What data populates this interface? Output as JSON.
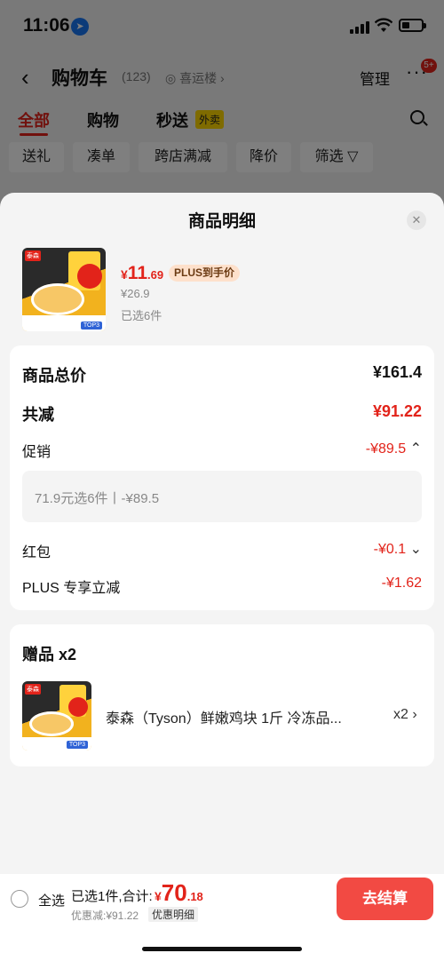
{
  "status_bar": {
    "time": "11:06"
  },
  "nav": {
    "title": "购物车",
    "count": "(123)",
    "address": "喜运楼 ›",
    "manage": "管理",
    "more_badge": "5+"
  },
  "tabs": [
    {
      "label": "全部"
    },
    {
      "label": "购物"
    },
    {
      "label": "秒送"
    }
  ],
  "tab_badge": "外卖",
  "filters": [
    "送礼",
    "凑单",
    "跨店满减",
    "降价",
    "筛选"
  ],
  "sheet": {
    "title": "商品明细",
    "product": {
      "currency": "¥",
      "price_int": "11",
      "price_dec": ".69",
      "plus_tag": "PLUS到手价",
      "original_price": "¥26.9",
      "selected": "已选6件",
      "thumb_brand": "泰森",
      "thumb_top": "TOP3"
    },
    "summary": {
      "total_label": "商品总价",
      "total_value": "¥161.4",
      "reduce_label": "共减",
      "reduce_value": "¥91.22",
      "promo_label": "促销",
      "promo_value": "-¥89.5",
      "promo_detail": "71.9元选6件丨-¥89.5",
      "redpacket_label": "红包",
      "redpacket_value": "-¥0.1",
      "plus_label": "PLUS 专享立减",
      "plus_value": "-¥1.62"
    },
    "gift": {
      "title": "赠品 x2",
      "name": "泰森（Tyson）鲜嫩鸡块 1斤 冷冻品...",
      "qty": "x2",
      "thumb_brand": "泰森",
      "thumb_top": "TOP3"
    }
  },
  "checkout": {
    "select_all": "全选",
    "summary_text": "已选1件,合计:",
    "currency": "¥",
    "total_int": "70",
    "total_dec": ".18",
    "discount_text": "优惠减:¥91.22",
    "detail_label": "优惠明细",
    "button_label": "去结算"
  },
  "colors": {
    "accent": "#e2231a",
    "button": "#f24a43",
    "plus_tag_bg": "#fde0cb",
    "badge_yellow": "#ffd600"
  },
  "icons": [
    "location-arrow-icon",
    "signal-icon",
    "wifi-icon",
    "battery-icon",
    "back-chevron-icon",
    "eye-icon",
    "more-dots-icon",
    "search-icon",
    "filter-funnel-icon",
    "close-icon",
    "chevron-up-icon",
    "chevron-down-icon",
    "chevron-right-icon",
    "radio-unchecked-icon"
  ]
}
